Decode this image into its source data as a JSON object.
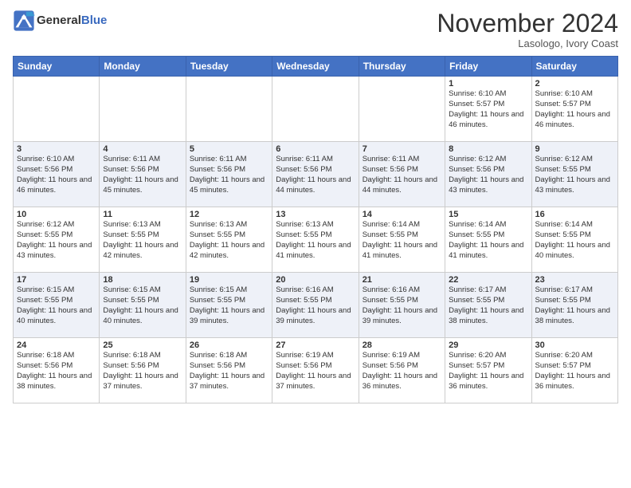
{
  "header": {
    "logo_line1": "General",
    "logo_line2": "Blue",
    "month_title": "November 2024",
    "location": "Lasologo, Ivory Coast"
  },
  "days_of_week": [
    "Sunday",
    "Monday",
    "Tuesday",
    "Wednesday",
    "Thursday",
    "Friday",
    "Saturday"
  ],
  "weeks": [
    [
      null,
      null,
      null,
      null,
      null,
      {
        "date": "1",
        "sunrise": "6:10 AM",
        "sunset": "5:57 PM",
        "daylight": "11 hours and 46 minutes."
      },
      {
        "date": "2",
        "sunrise": "6:10 AM",
        "sunset": "5:57 PM",
        "daylight": "11 hours and 46 minutes."
      }
    ],
    [
      {
        "date": "3",
        "sunrise": "6:10 AM",
        "sunset": "5:56 PM",
        "daylight": "11 hours and 46 minutes."
      },
      {
        "date": "4",
        "sunrise": "6:11 AM",
        "sunset": "5:56 PM",
        "daylight": "11 hours and 45 minutes."
      },
      {
        "date": "5",
        "sunrise": "6:11 AM",
        "sunset": "5:56 PM",
        "daylight": "11 hours and 45 minutes."
      },
      {
        "date": "6",
        "sunrise": "6:11 AM",
        "sunset": "5:56 PM",
        "daylight": "11 hours and 44 minutes."
      },
      {
        "date": "7",
        "sunrise": "6:11 AM",
        "sunset": "5:56 PM",
        "daylight": "11 hours and 44 minutes."
      },
      {
        "date": "8",
        "sunrise": "6:12 AM",
        "sunset": "5:56 PM",
        "daylight": "11 hours and 43 minutes."
      },
      {
        "date": "9",
        "sunrise": "6:12 AM",
        "sunset": "5:55 PM",
        "daylight": "11 hours and 43 minutes."
      }
    ],
    [
      {
        "date": "10",
        "sunrise": "6:12 AM",
        "sunset": "5:55 PM",
        "daylight": "11 hours and 43 minutes."
      },
      {
        "date": "11",
        "sunrise": "6:13 AM",
        "sunset": "5:55 PM",
        "daylight": "11 hours and 42 minutes."
      },
      {
        "date": "12",
        "sunrise": "6:13 AM",
        "sunset": "5:55 PM",
        "daylight": "11 hours and 42 minutes."
      },
      {
        "date": "13",
        "sunrise": "6:13 AM",
        "sunset": "5:55 PM",
        "daylight": "11 hours and 41 minutes."
      },
      {
        "date": "14",
        "sunrise": "6:14 AM",
        "sunset": "5:55 PM",
        "daylight": "11 hours and 41 minutes."
      },
      {
        "date": "15",
        "sunrise": "6:14 AM",
        "sunset": "5:55 PM",
        "daylight": "11 hours and 41 minutes."
      },
      {
        "date": "16",
        "sunrise": "6:14 AM",
        "sunset": "5:55 PM",
        "daylight": "11 hours and 40 minutes."
      }
    ],
    [
      {
        "date": "17",
        "sunrise": "6:15 AM",
        "sunset": "5:55 PM",
        "daylight": "11 hours and 40 minutes."
      },
      {
        "date": "18",
        "sunrise": "6:15 AM",
        "sunset": "5:55 PM",
        "daylight": "11 hours and 40 minutes."
      },
      {
        "date": "19",
        "sunrise": "6:15 AM",
        "sunset": "5:55 PM",
        "daylight": "11 hours and 39 minutes."
      },
      {
        "date": "20",
        "sunrise": "6:16 AM",
        "sunset": "5:55 PM",
        "daylight": "11 hours and 39 minutes."
      },
      {
        "date": "21",
        "sunrise": "6:16 AM",
        "sunset": "5:55 PM",
        "daylight": "11 hours and 39 minutes."
      },
      {
        "date": "22",
        "sunrise": "6:17 AM",
        "sunset": "5:55 PM",
        "daylight": "11 hours and 38 minutes."
      },
      {
        "date": "23",
        "sunrise": "6:17 AM",
        "sunset": "5:55 PM",
        "daylight": "11 hours and 38 minutes."
      }
    ],
    [
      {
        "date": "24",
        "sunrise": "6:18 AM",
        "sunset": "5:56 PM",
        "daylight": "11 hours and 38 minutes."
      },
      {
        "date": "25",
        "sunrise": "6:18 AM",
        "sunset": "5:56 PM",
        "daylight": "11 hours and 37 minutes."
      },
      {
        "date": "26",
        "sunrise": "6:18 AM",
        "sunset": "5:56 PM",
        "daylight": "11 hours and 37 minutes."
      },
      {
        "date": "27",
        "sunrise": "6:19 AM",
        "sunset": "5:56 PM",
        "daylight": "11 hours and 37 minutes."
      },
      {
        "date": "28",
        "sunrise": "6:19 AM",
        "sunset": "5:56 PM",
        "daylight": "11 hours and 36 minutes."
      },
      {
        "date": "29",
        "sunrise": "6:20 AM",
        "sunset": "5:57 PM",
        "daylight": "11 hours and 36 minutes."
      },
      {
        "date": "30",
        "sunrise": "6:20 AM",
        "sunset": "5:57 PM",
        "daylight": "11 hours and 36 minutes."
      }
    ]
  ],
  "labels": {
    "sunrise_prefix": "Sunrise: ",
    "sunset_prefix": "Sunset: ",
    "daylight_prefix": "Daylight: "
  }
}
